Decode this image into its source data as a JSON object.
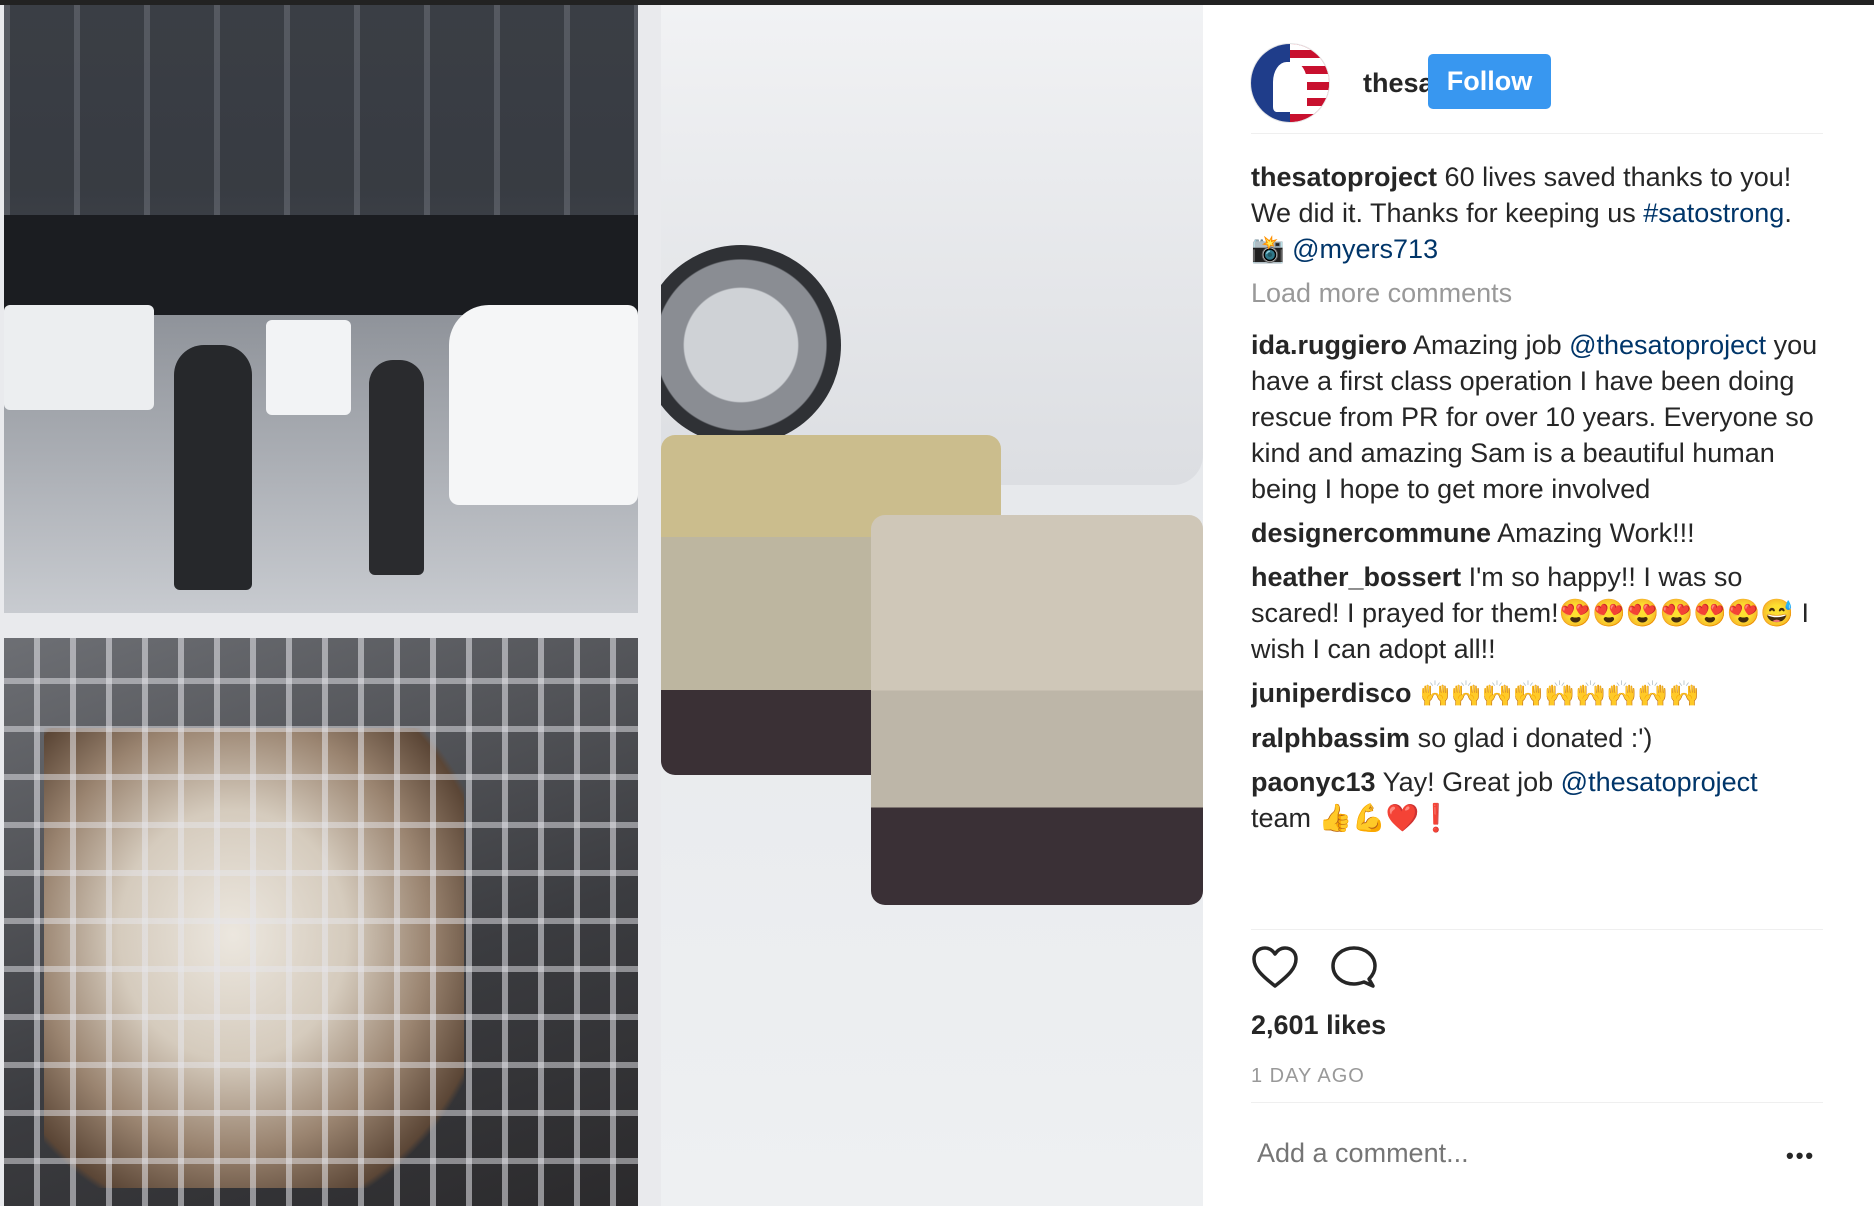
{
  "post": {
    "username": "thesatoproject",
    "follow_label": "Follow",
    "caption": {
      "user": "thesatoproject",
      "text1": " 60 lives saved thanks to you! We did it. Thanks for keeping us ",
      "hashtag": "#satostrong",
      "text2": ". 📸 ",
      "mention": "@myers713"
    },
    "load_more": "Load more comments",
    "comments": [
      {
        "user": "ida.ruggiero",
        "pre": " Amazing job ",
        "mention": "@thesatoproject",
        "post": " you have a first class operation I have been doing rescue from PR for over 10 years. Everyone so kind and amazing Sam is a beautiful human being I hope to get more involved"
      },
      {
        "user": "designercommune",
        "pre": " Amazing Work!!!",
        "mention": "",
        "post": ""
      },
      {
        "user": "heather_bossert",
        "pre": " I'm so happy!! I was so scared! I prayed for them!😍😍😍😍😍😍😅 I wish I can adopt all!!",
        "mention": "",
        "post": ""
      },
      {
        "user": "juniperdisco",
        "pre": " 🙌🙌🙌🙌🙌🙌🙌🙌🙌",
        "mention": "",
        "post": ""
      },
      {
        "user": "ralphbassim",
        "pre": " so glad i donated :')",
        "mention": "",
        "post": ""
      },
      {
        "user": "paonyc13",
        "pre": " Yay! Great job ",
        "mention": "@thesatoproject",
        "post": " team 👍💪❤️❗"
      }
    ],
    "likes": "2,601 likes",
    "time": "1 DAY AGO",
    "add_comment_placeholder": "Add a comment...",
    "more_label": "•••"
  },
  "colors": {
    "follow_bg": "#3897f0",
    "link": "#003569",
    "muted": "#999999",
    "text": "#262626"
  },
  "icons": {
    "like": "heart-icon",
    "comment": "comment-icon",
    "more": "more-options-icon"
  }
}
